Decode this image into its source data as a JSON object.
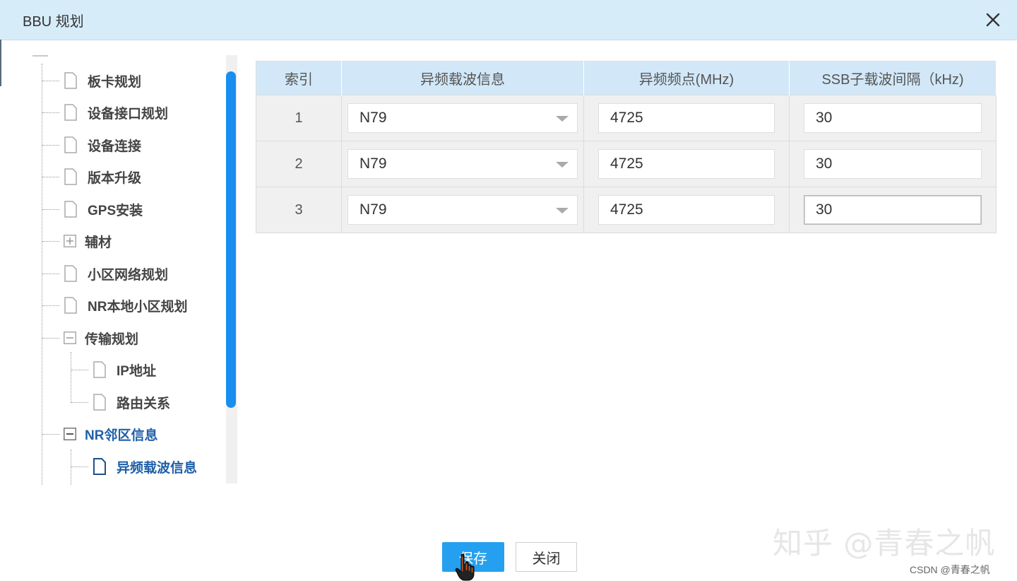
{
  "window": {
    "title": "BBU 规划",
    "close_icon": "close-icon"
  },
  "tree": {
    "items": [
      {
        "label": "板卡规划",
        "icon": "file-icon"
      },
      {
        "label": "设备接口规划",
        "icon": "file-icon"
      },
      {
        "label": "设备连接",
        "icon": "file-icon"
      },
      {
        "label": "版本升级",
        "icon": "file-icon"
      },
      {
        "label": "GPS安装",
        "icon": "file-icon"
      },
      {
        "label": "辅材",
        "icon": "expand-plus-icon"
      },
      {
        "label": "小区网络规划",
        "icon": "file-icon"
      },
      {
        "label": "NR本地小区规划",
        "icon": "file-icon"
      },
      {
        "label": "传输规划",
        "icon": "collapse-minus-icon"
      },
      {
        "label": "IP地址",
        "icon": "file-icon"
      },
      {
        "label": "路由关系",
        "icon": "file-icon"
      },
      {
        "label": "NR邻区信息",
        "icon": "collapse-minus-icon"
      },
      {
        "label": "异频载波信息",
        "icon": "file-icon"
      }
    ],
    "active_color": "#1f5fa8"
  },
  "table": {
    "headers": [
      "索引",
      "异频载波信息",
      "异频频点(MHz)",
      "SSB子载波间隔（kHz)"
    ],
    "rows": [
      {
        "index": "1",
        "carrier": "N79",
        "freq": "4725",
        "ssb": "30"
      },
      {
        "index": "2",
        "carrier": "N79",
        "freq": "4725",
        "ssb": "30"
      },
      {
        "index": "3",
        "carrier": "N79",
        "freq": "4725",
        "ssb": "30"
      }
    ]
  },
  "buttons": {
    "save": "保存",
    "close": "关闭"
  },
  "colors": {
    "titlebar": "#d7ecf9",
    "header": "#d2e8f8",
    "primary": "#25a0f0",
    "scroll_thumb": "#1a8ef0"
  },
  "watermark": {
    "main": "知乎 @青春之帆",
    "small": "CSDN @青春之帆"
  }
}
